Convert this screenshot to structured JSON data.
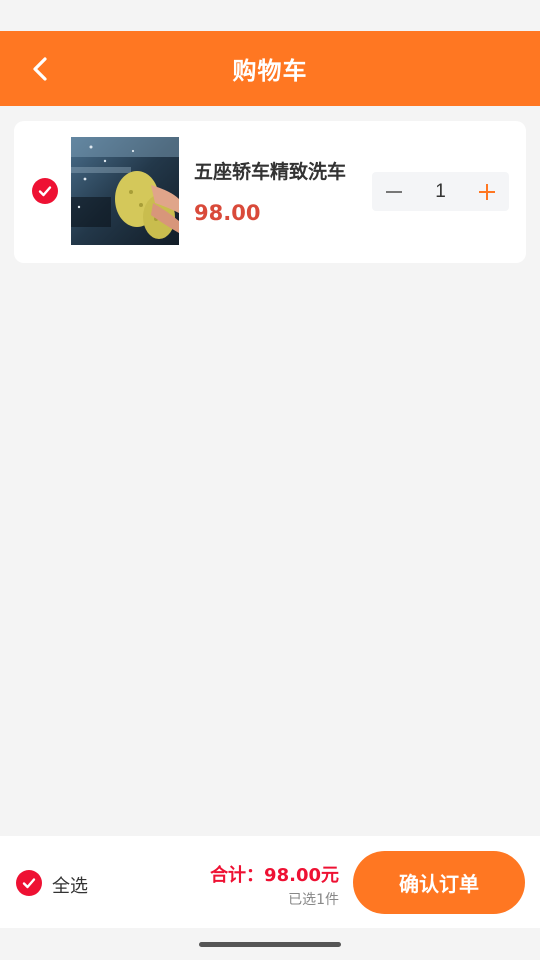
{
  "header": {
    "title": "购物车",
    "back_icon": "chevron-left-icon"
  },
  "cart": {
    "items": [
      {
        "checked": true,
        "name": "五座轿车精致洗车",
        "price": "98.00",
        "quantity": "1",
        "image_icon": "car-wash-photo"
      }
    ]
  },
  "footer": {
    "select_all_label": "全选",
    "total_text": "合计：98.00元",
    "selected_text": "已选1件",
    "confirm_label": "确认订单"
  },
  "colors": {
    "accent": "#ff7722",
    "check": "#ee1133",
    "price": "#d94a3a"
  }
}
